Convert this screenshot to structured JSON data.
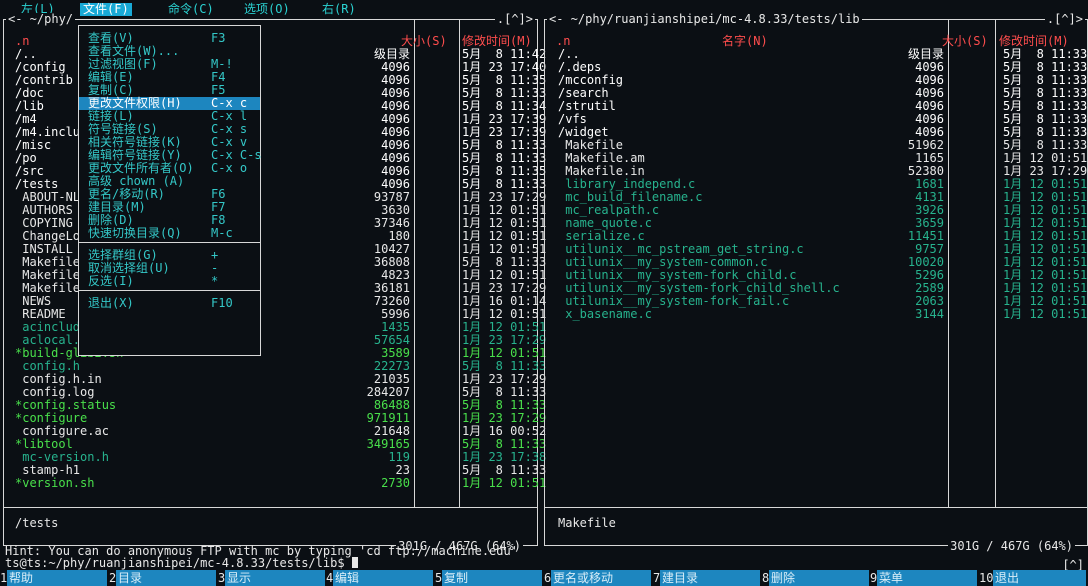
{
  "menubar": {
    "items": [
      {
        "label": "左(L)"
      },
      {
        "label": "文件(F)"
      },
      {
        "label": "命令(C)"
      },
      {
        "label": "选项(O)"
      },
      {
        "label": "右(R)"
      }
    ]
  },
  "file_menu": {
    "groups": [
      [
        {
          "label": "查看(V)",
          "key": "F3"
        },
        {
          "label": "查看文件(W)...",
          "key": ""
        },
        {
          "label": "过滤视图(F)",
          "key": "M-!"
        },
        {
          "label": "编辑(E)",
          "key": "F4"
        },
        {
          "label": "复制(C)",
          "key": "F5"
        },
        {
          "label": "更改文件权限(H)",
          "key": "C-x c",
          "highlight": true
        },
        {
          "label": "链接(L)",
          "key": "C-x l"
        },
        {
          "label": "符号链接(S)",
          "key": "C-x s"
        },
        {
          "label": "相关符号链接(K)",
          "key": "C-x v"
        },
        {
          "label": "编辑符号链接(Y)",
          "key": "C-x C-s"
        },
        {
          "label": "更改文件所有者(O)",
          "key": "C-x o"
        },
        {
          "label": "高级 chown (A)",
          "key": ""
        },
        {
          "label": "更名/移动(R)",
          "key": "F6"
        },
        {
          "label": "建目录(M)",
          "key": "F7"
        },
        {
          "label": "删除(D)",
          "key": "F8"
        },
        {
          "label": "快速切换目录(Q)",
          "key": "M-c"
        }
      ],
      [
        {
          "label": "选择群组(G)",
          "key": "+"
        },
        {
          "label": "取消选择组(U)",
          "key": "-"
        },
        {
          "label": "反选(I)",
          "key": "*"
        }
      ],
      [
        {
          "label": "退出(X)",
          "key": "F10"
        }
      ]
    ]
  },
  "left_panel": {
    "path": "<- ~/phy/",
    "indicator": ".[^]>",
    "col_name": ".n",
    "col_size": "大小(S)",
    "col_mtime": "修改时间(M)",
    "rows": [
      {
        "name": "/..",
        "size": "级目录",
        "mtime": "5月  8 11:42",
        "kind": "dir"
      },
      {
        "name": "/config",
        "size": "4096",
        "mtime": "1月 23 17:40",
        "kind": "dir"
      },
      {
        "name": "/contrib",
        "size": "4096",
        "mtime": "5月  8 11:35",
        "kind": "dir"
      },
      {
        "name": "/doc",
        "size": "4096",
        "mtime": "5月  8 11:33",
        "kind": "dir"
      },
      {
        "name": "/lib",
        "size": "4096",
        "mtime": "5月  8 11:34",
        "kind": "dir"
      },
      {
        "name": "/m4",
        "size": "4096",
        "mtime": "1月 23 17:39",
        "kind": "dir"
      },
      {
        "name": "/m4.inclu",
        "size": "4096",
        "mtime": "1月 23 17:39",
        "kind": "dir"
      },
      {
        "name": "/misc",
        "size": "4096",
        "mtime": "5月  8 11:33",
        "kind": "dir"
      },
      {
        "name": "/po",
        "size": "4096",
        "mtime": "5月  8 11:33",
        "kind": "dir"
      },
      {
        "name": "/src",
        "size": "4096",
        "mtime": "5月  8 11:35",
        "kind": "dir"
      },
      {
        "name": "/tests",
        "size": "4096",
        "mtime": "5月  8 11:33",
        "kind": "dir"
      },
      {
        "name": " ABOUT-NL",
        "size": "93787",
        "mtime": "1月 23 17:29",
        "kind": "file"
      },
      {
        "name": " AUTHORS",
        "size": "3630",
        "mtime": "1月 12 01:51",
        "kind": "file"
      },
      {
        "name": " COPYING",
        "size": "37346",
        "mtime": "1月 12 01:51",
        "kind": "file"
      },
      {
        "name": " ChangeLo",
        "size": "180",
        "mtime": "1月 12 01:51",
        "kind": "file"
      },
      {
        "name": " INSTALL",
        "size": "10427",
        "mtime": "1月 12 01:51",
        "kind": "file"
      },
      {
        "name": " Makefile",
        "size": "36808",
        "mtime": "5月  8 11:33",
        "kind": "file"
      },
      {
        "name": " Makefile",
        "size": "4823",
        "mtime": "1月 12 01:51",
        "kind": "file"
      },
      {
        "name": " Makefile",
        "size": "36181",
        "mtime": "1月 23 17:29",
        "kind": "file"
      },
      {
        "name": " NEWS",
        "size": "73260",
        "mtime": "1月 16 01:14",
        "kind": "file"
      },
      {
        "name": " README",
        "size": "5996",
        "mtime": "1月 12 01:51",
        "kind": "file"
      },
      {
        "name": " acinclud",
        "size": "1435",
        "mtime": "1月 12 01:51",
        "kind": "src"
      },
      {
        "name": " aclocal.m4",
        "size": "57654",
        "mtime": "1月 23 17:29",
        "kind": "src"
      },
      {
        "name": "*build-glib2.sh",
        "size": "3589",
        "mtime": "1月 12 01:51",
        "kind": "exe"
      },
      {
        "name": " config.h",
        "size": "22273",
        "mtime": "5月  8 11:33",
        "kind": "src"
      },
      {
        "name": " config.h.in",
        "size": "21035",
        "mtime": "1月 23 17:29",
        "kind": "file"
      },
      {
        "name": " config.log",
        "size": "284207",
        "mtime": "5月  8 11:33",
        "kind": "file"
      },
      {
        "name": "*config.status",
        "size": "86488",
        "mtime": "5月  8 11:33",
        "kind": "exe"
      },
      {
        "name": "*configure",
        "size": "971911",
        "mtime": "1月 23 17:29",
        "kind": "exe"
      },
      {
        "name": " configure.ac",
        "size": "21648",
        "mtime": "1月 16 00:52",
        "kind": "file"
      },
      {
        "name": "*libtool",
        "size": "349165",
        "mtime": "5月  8 11:33",
        "kind": "exe"
      },
      {
        "name": " mc-version.h",
        "size": "119",
        "mtime": "1月 23 17:38",
        "kind": "src"
      },
      {
        "name": " stamp-h1",
        "size": "23",
        "mtime": "5月  8 11:33",
        "kind": "file"
      },
      {
        "name": "*version.sh",
        "size": "2730",
        "mtime": "1月 12 01:51",
        "kind": "exe"
      }
    ],
    "status_file": "/tests",
    "free_space": "301G / 467G (64%)"
  },
  "right_panel": {
    "path": "<- ~/phy/ruanjianshipei/mc-4.8.33/tests/lib",
    "indicator": ".[^]>",
    "col_name": ".n",
    "col_name_title": "名字(N)",
    "col_size": "大小(S)",
    "col_mtime": "修改时间(M)",
    "rows": [
      {
        "name": "/..",
        "size": "级目录",
        "mtime": "5月  8 11:33",
        "kind": "dir"
      },
      {
        "name": "/.deps",
        "size": "4096",
        "mtime": "5月  8 11:33",
        "kind": "dir"
      },
      {
        "name": "/mcconfig",
        "size": "4096",
        "mtime": "5月  8 11:33",
        "kind": "dir"
      },
      {
        "name": "/search",
        "size": "4096",
        "mtime": "5月  8 11:33",
        "kind": "dir"
      },
      {
        "name": "/strutil",
        "size": "4096",
        "mtime": "5月  8 11:33",
        "kind": "dir"
      },
      {
        "name": "/vfs",
        "size": "4096",
        "mtime": "5月  8 11:33",
        "kind": "dir"
      },
      {
        "name": "/widget",
        "size": "4096",
        "mtime": "5月  8 11:33",
        "kind": "dir"
      },
      {
        "name": " Makefile",
        "size": "51962",
        "mtime": "5月  8 11:33",
        "kind": "file"
      },
      {
        "name": " Makefile.am",
        "size": "1165",
        "mtime": "1月 12 01:51",
        "kind": "file"
      },
      {
        "name": " Makefile.in",
        "size": "52380",
        "mtime": "1月 23 17:29",
        "kind": "file"
      },
      {
        "name": " library_independ.c",
        "size": "1681",
        "mtime": "1月 12 01:51",
        "kind": "src"
      },
      {
        "name": " mc_build_filename.c",
        "size": "4131",
        "mtime": "1月 12 01:51",
        "kind": "src"
      },
      {
        "name": " mc_realpath.c",
        "size": "3926",
        "mtime": "1月 12 01:51",
        "kind": "src"
      },
      {
        "name": " name_quote.c",
        "size": "3659",
        "mtime": "1月 12 01:51",
        "kind": "src"
      },
      {
        "name": " serialize.c",
        "size": "11451",
        "mtime": "1月 12 01:51",
        "kind": "src"
      },
      {
        "name": " utilunix__mc_pstream_get_string.c",
        "size": "9757",
        "mtime": "1月 12 01:51",
        "kind": "src"
      },
      {
        "name": " utilunix__my_system-common.c",
        "size": "10020",
        "mtime": "1月 12 01:51",
        "kind": "src"
      },
      {
        "name": " utilunix__my_system-fork_child.c",
        "size": "5296",
        "mtime": "1月 12 01:51",
        "kind": "src"
      },
      {
        "name": " utilunix__my_system-fork_child_shell.c",
        "size": "2589",
        "mtime": "1月 12 01:51",
        "kind": "src"
      },
      {
        "name": " utilunix__my_system-fork_fail.c",
        "size": "2063",
        "mtime": "1月 12 01:51",
        "kind": "src"
      },
      {
        "name": " x_basename.c",
        "size": "3144",
        "mtime": "1月 12 01:51",
        "kind": "src"
      }
    ],
    "status_file": "Makefile",
    "free_space": "301G / 467G (64%)"
  },
  "hint": "Hint: You can do anonymous FTP with mc by typing 'cd ftp://machine.edu'",
  "prompt": "ts@ts:~/phy/ruanjianshipei/mc-4.8.33/tests/lib$ ",
  "prompt_indicator": "[^]",
  "fkeys": [
    {
      "num": "1",
      "label": "帮助"
    },
    {
      "num": "2",
      "label": "目录"
    },
    {
      "num": "3",
      "label": "显示"
    },
    {
      "num": "4",
      "label": "编辑"
    },
    {
      "num": "5",
      "label": "复制"
    },
    {
      "num": "6",
      "label": "更名或移动"
    },
    {
      "num": "7",
      "label": "建目录"
    },
    {
      "num": "8",
      "label": "删除"
    },
    {
      "num": "9",
      "label": "菜单"
    },
    {
      "num": "10",
      "label": "退出"
    }
  ],
  "colors": {
    "background": "#0b0f14",
    "menu_cyan": "#2bd2d2",
    "menu_active": "#19a9d6",
    "header_red": "#ff4d4d",
    "source_green": "#27b38e",
    "exec_green": "#49e04b",
    "fkey_blue": "#1d86bf"
  }
}
